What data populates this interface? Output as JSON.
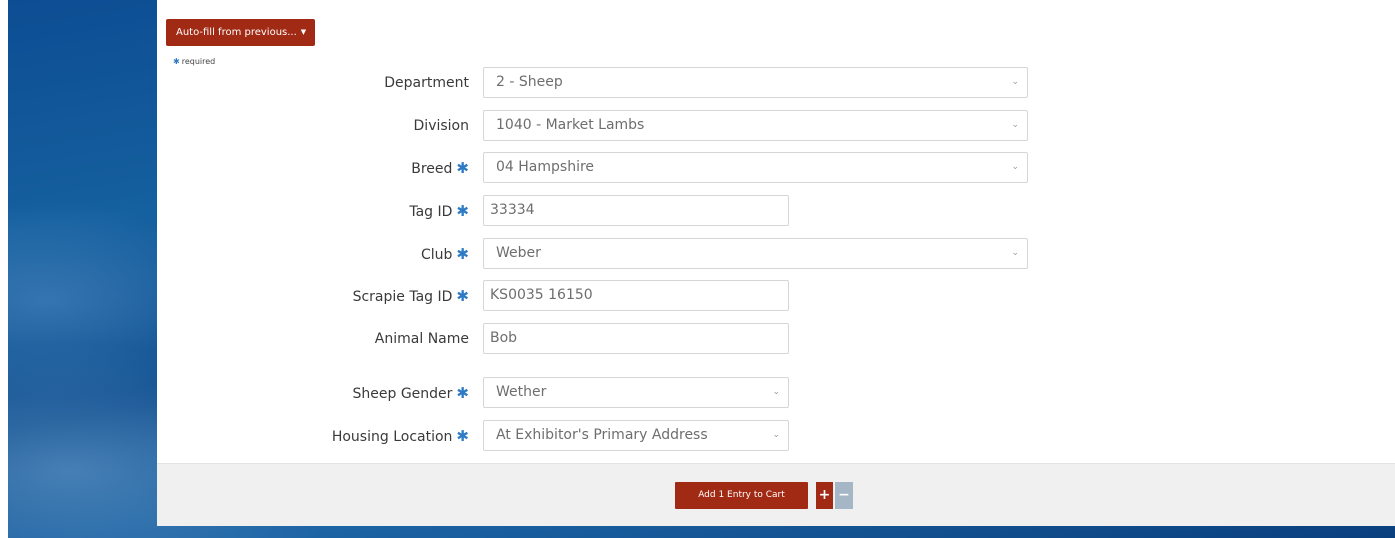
{
  "autofill": {
    "label": "Auto-fill from previous...",
    "caret": "▼"
  },
  "required_note": {
    "asterisk": "✱",
    "text": "required"
  },
  "fields": {
    "department": {
      "label": "Department",
      "value": "2 - Sheep"
    },
    "division": {
      "label": "Division",
      "value": "1040 - Market Lambs"
    },
    "breed": {
      "label": "Breed",
      "value": "04 Hampshire"
    },
    "tag_id": {
      "label": "Tag ID",
      "value": "33334"
    },
    "club": {
      "label": "Club",
      "value": "Weber"
    },
    "scrapie_tag_id": {
      "label": "Scrapie Tag ID",
      "value": "KS0035 16150"
    },
    "animal_name": {
      "label": "Animal Name",
      "value": "Bob"
    },
    "sheep_gender": {
      "label": "Sheep Gender",
      "value": "Wether"
    },
    "housing_location": {
      "label": "Housing Location",
      "value": "At Exhibitor's Primary Address"
    }
  },
  "required_asterisk": "✱",
  "chevron": "⌄",
  "footer": {
    "add_label": "Add 1 Entry to Cart",
    "plus": "+",
    "minus": "−"
  },
  "colors": {
    "brand_red": "#a12a14",
    "required_blue": "#2e7bc4",
    "minus_gray": "#a5b6c6"
  }
}
